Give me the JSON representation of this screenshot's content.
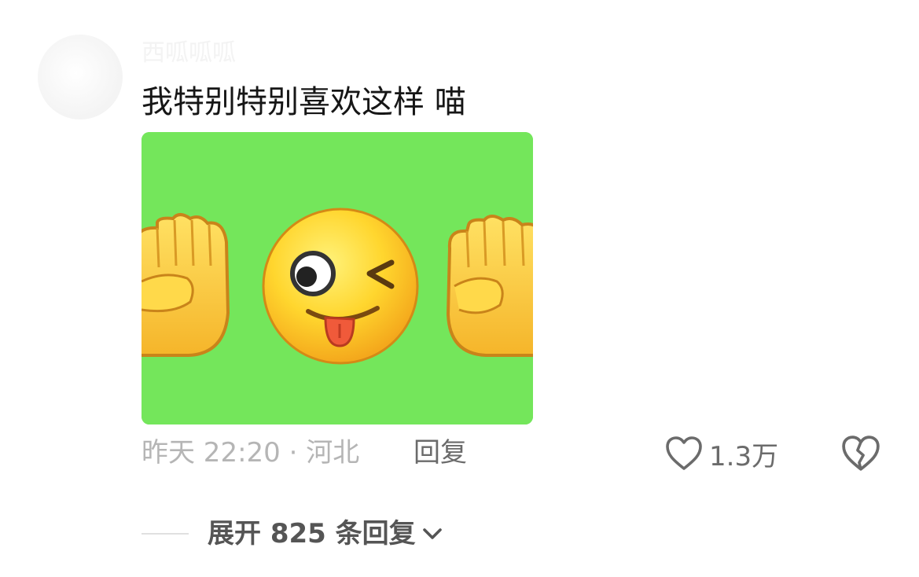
{
  "comment": {
    "username": "西呱呱呱",
    "text": "我特别特别喜欢这样 喵",
    "media_alt": "emoji sticker: raised fist, winking face with tongue, raised fist on green background",
    "meta": "昨天 22:20 · 河北",
    "reply_label": "回复",
    "like_count": "1.3万",
    "expand_label": "展开 825 条回复"
  },
  "colors": {
    "sticker_background": "#74e65b",
    "primary_text": "#161616",
    "secondary_text": "#b5b5b5",
    "action_text": "#6b6b6b"
  },
  "icons": {
    "like": "heart-outline-icon",
    "dislike": "broken-heart-icon",
    "expand": "chevron-down-icon"
  }
}
